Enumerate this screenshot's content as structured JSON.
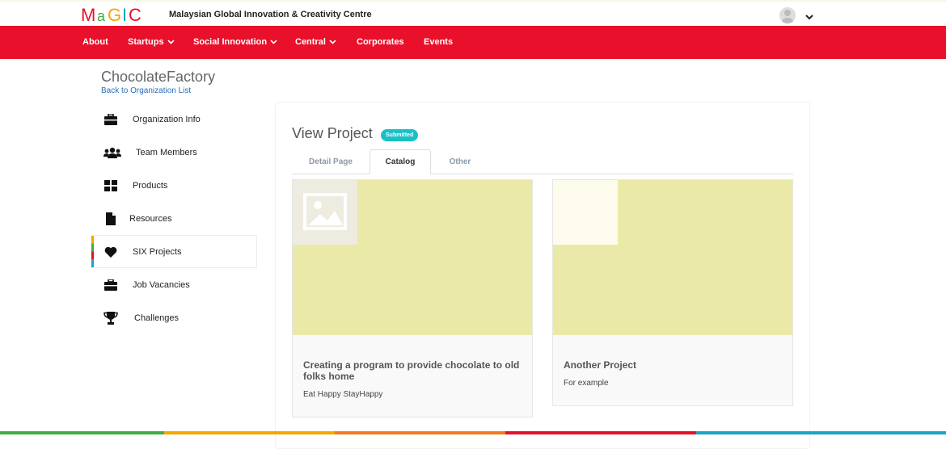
{
  "header": {
    "logo_text": "MaGIC",
    "site_name": "Malaysian Global Innovation & Creativity Centre",
    "logo_colors": [
      "#e8102a",
      "#3fae49",
      "#f7a600",
      "#1aa5c7",
      "#e8102a"
    ]
  },
  "nav": {
    "items": [
      {
        "label": "About",
        "has_dropdown": false
      },
      {
        "label": "Startups",
        "has_dropdown": true
      },
      {
        "label": "Social Innovation",
        "has_dropdown": true
      },
      {
        "label": "Central",
        "has_dropdown": true
      },
      {
        "label": "Corporates",
        "has_dropdown": false
      },
      {
        "label": "Events",
        "has_dropdown": false
      }
    ],
    "background": "#e8102a"
  },
  "sidebar": {
    "org_name": "ChocolateFactory",
    "back_link": "Back to Organization List",
    "items": [
      {
        "label": "Organization Info",
        "icon": "briefcase-icon"
      },
      {
        "label": "Team Members",
        "icon": "users-icon"
      },
      {
        "label": "Products",
        "icon": "grid-icon"
      },
      {
        "label": "Resources",
        "icon": "file-icon"
      },
      {
        "label": "SIX Projects",
        "icon": "heart-icon",
        "active": true
      },
      {
        "label": "Job Vacancies",
        "icon": "briefcase-icon"
      },
      {
        "label": "Challenges",
        "icon": "trophy-icon"
      }
    ]
  },
  "main": {
    "title": "View Project",
    "status_badge": "Submitted",
    "tabs": [
      {
        "label": "Detail Page",
        "active": false
      },
      {
        "label": "Catalog",
        "active": true
      },
      {
        "label": "Other",
        "active": false
      }
    ],
    "projects": [
      {
        "title": "Creating a program to provide chocolate to old folks home",
        "subtitle": "Eat Happy StayHappy",
        "image": "image-placeholder-icon"
      },
      {
        "title": "Another Project",
        "subtitle": "For example",
        "image": "blank-thumbnail"
      }
    ]
  },
  "footer_stripe_colors": [
    "#3fae49",
    "#f7a600",
    "#f47b20",
    "#e8102a",
    "#1aa5c7"
  ]
}
